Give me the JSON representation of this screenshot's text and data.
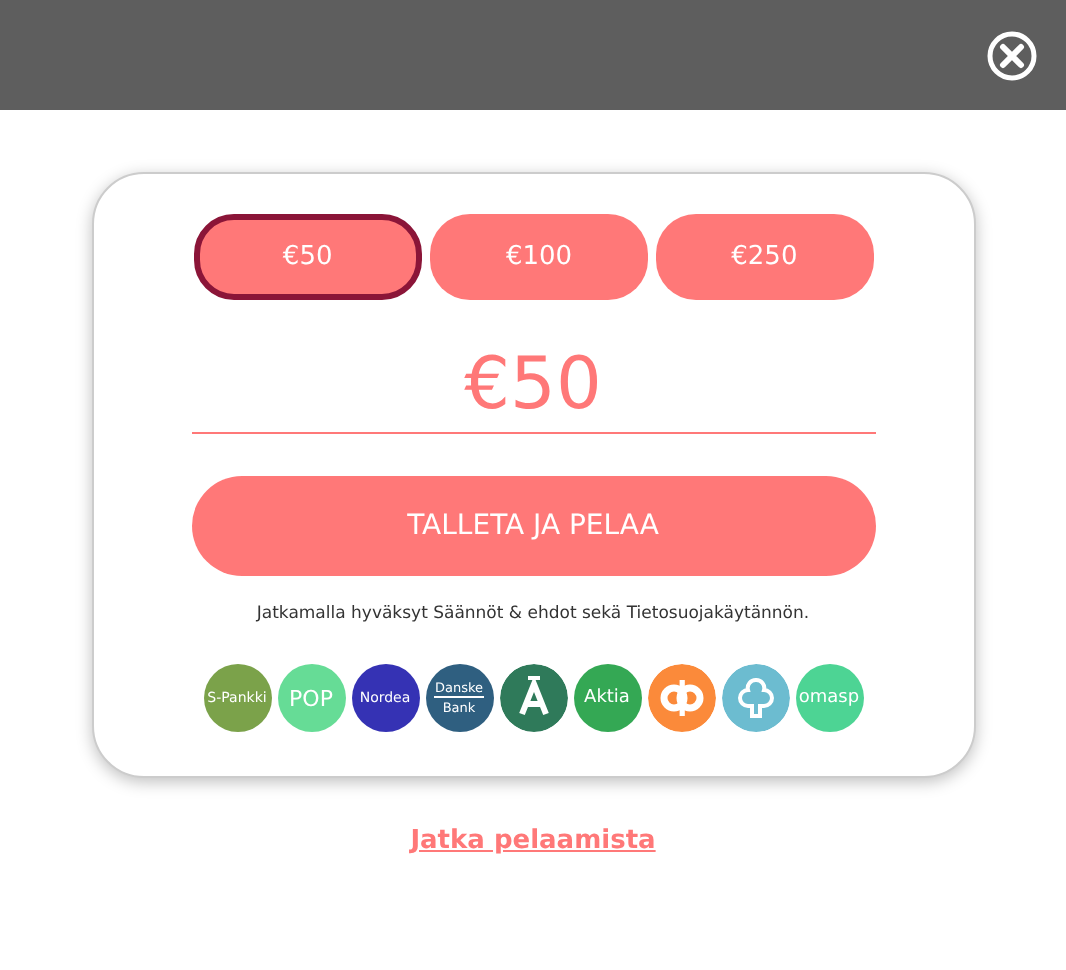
{
  "amounts": [
    {
      "label": "€50",
      "selected": true
    },
    {
      "label": "€100",
      "selected": false
    },
    {
      "label": "€250",
      "selected": false
    }
  ],
  "amount_value": "€50",
  "deposit_button": "TALLETA JA PELAA",
  "terms_text": "Jatkamalla hyväksyt Säännöt & ehdot sekä Tietosuojakäytännön.",
  "banks": [
    {
      "kind": "text",
      "label": "S-Pankki",
      "color": "#7ba24a"
    },
    {
      "kind": "text",
      "label": "POP",
      "color": "#66dc96"
    },
    {
      "kind": "text",
      "label": "Nordea",
      "color": "#3532b4"
    },
    {
      "kind": "split",
      "label": "Danske",
      "label_2": "Bank",
      "color": "#2f5f80"
    },
    {
      "kind": "letter-a",
      "color": "#2f7a5a"
    },
    {
      "kind": "text",
      "label": "Aktia",
      "color": "#34a854"
    },
    {
      "kind": "op",
      "color": "#fb8a3a"
    },
    {
      "kind": "tree",
      "color": "#6cbcd0"
    },
    {
      "kind": "text",
      "label": "omasp",
      "color": "#4dd494"
    }
  ],
  "continue_link": "Jatka pelaamista"
}
